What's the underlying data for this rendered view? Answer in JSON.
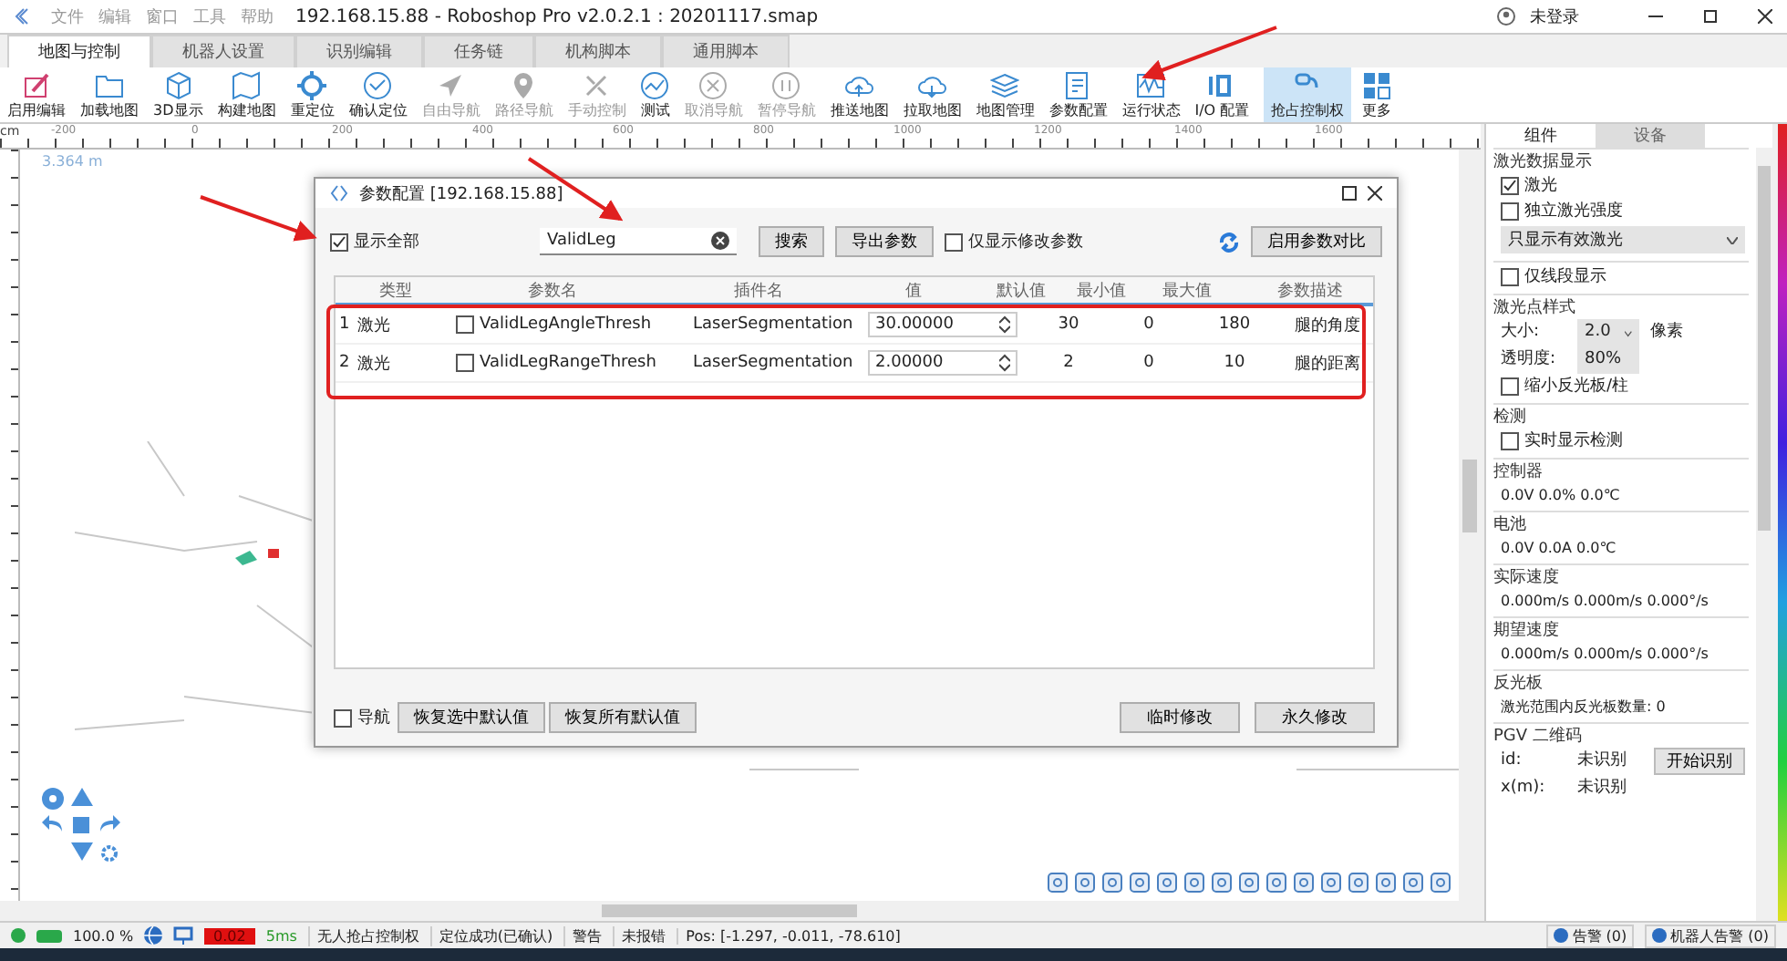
{
  "window": {
    "title": "192.168.15.88 - Roboshop Pro v2.0.2.1 : 20201117.smap",
    "menu": [
      "文件",
      "编辑",
      "窗口",
      "工具",
      "帮助"
    ],
    "user": "未登录"
  },
  "ribbon_tabs": [
    {
      "label": "地图与控制",
      "selected": true
    },
    {
      "label": "机器人设置",
      "selected": false
    },
    {
      "label": "识别编辑",
      "selected": false
    },
    {
      "label": "任务链",
      "selected": false
    },
    {
      "label": "机构脚本",
      "selected": false
    },
    {
      "label": "通用脚本",
      "selected": false
    }
  ],
  "toolbar": [
    {
      "label": "启用编辑",
      "disabled": false,
      "selected": false
    },
    {
      "label": "加载地图",
      "disabled": false,
      "selected": false
    },
    {
      "label": "3D显示",
      "disabled": false,
      "selected": false
    },
    {
      "label": "构建地图",
      "disabled": false,
      "selected": false
    },
    {
      "label": "重定位",
      "disabled": false,
      "selected": false
    },
    {
      "label": "确认定位",
      "disabled": false,
      "selected": false
    },
    {
      "label": "自由导航",
      "disabled": true,
      "selected": false
    },
    {
      "label": "路径导航",
      "disabled": true,
      "selected": false
    },
    {
      "label": "手动控制",
      "disabled": true,
      "selected": false
    },
    {
      "label": "测试",
      "disabled": false,
      "selected": false
    },
    {
      "label": "取消导航",
      "disabled": true,
      "selected": false
    },
    {
      "label": "暂停导航",
      "disabled": true,
      "selected": false
    },
    {
      "label": "推送地图",
      "disabled": false,
      "selected": false
    },
    {
      "label": "拉取地图",
      "disabled": false,
      "selected": false
    },
    {
      "label": "地图管理",
      "disabled": false,
      "selected": false
    },
    {
      "label": "参数配置",
      "disabled": false,
      "selected": false
    },
    {
      "label": "运行状态",
      "disabled": false,
      "selected": false
    },
    {
      "label": "I/O 配置",
      "disabled": false,
      "selected": false
    },
    {
      "label": "抢占控制权",
      "disabled": false,
      "selected": true
    },
    {
      "label": "更多",
      "disabled": false,
      "selected": false
    }
  ],
  "ruler": {
    "unit": "cm",
    "labels": [
      "-200",
      "0",
      "200",
      "400",
      "600",
      "800",
      "1000",
      "1200",
      "1400",
      "1600"
    ]
  },
  "scale_label": "3.364 m",
  "dialog": {
    "title": "参数配置 [192.168.15.88]",
    "show_all": {
      "label": "显示全部",
      "checked": true
    },
    "search": {
      "value": "ValidLeg"
    },
    "search_button": "搜索",
    "export_button": "导出参数",
    "modified_only": {
      "label": "仅显示修改参数",
      "checked": false
    },
    "compare_button": "启用参数对比",
    "columns": [
      "类型",
      "参数名",
      "插件名",
      "值",
      "默认值",
      "最小值",
      "最大值",
      "参数描述"
    ],
    "rows": [
      {
        "index": "1",
        "type": "激光",
        "name": "ValidLegAngleThresh",
        "checked": false,
        "plugin": "LaserSegmentation",
        "value": "30.00000",
        "default": "30",
        "min": "0",
        "max": "180",
        "description": "腿的角度"
      },
      {
        "index": "2",
        "type": "激光",
        "name": "ValidLegRangeThresh",
        "checked": false,
        "plugin": "LaserSegmentation",
        "value": "2.00000",
        "default": "2",
        "min": "0",
        "max": "10",
        "description": "腿的距离"
      }
    ],
    "nav_check": {
      "label": "导航",
      "checked": false
    },
    "footer_left": [
      "恢复选中默认值",
      "恢复所有默认值"
    ],
    "footer_right": [
      "临时修改",
      "永久修改"
    ]
  },
  "side_panel": {
    "tabs": [
      {
        "label": "组件",
        "selected": true
      },
      {
        "label": "设备",
        "selected": false
      }
    ],
    "sections": [
      {
        "title": "激光数据显示",
        "items": [
          {
            "kind": "checkbox",
            "label": "激光",
            "checked": true
          },
          {
            "kind": "checkbox",
            "label": "独立激光强度",
            "checked": false
          },
          {
            "kind": "select",
            "value": "只显示有效激光"
          }
        ]
      },
      {
        "items": [
          {
            "kind": "checkbox",
            "label": "仅线段显示",
            "checked": false
          }
        ]
      },
      {
        "title": "激光点样式",
        "items": [
          {
            "kind": "select-row",
            "label": "大小:",
            "value": "2.0",
            "unit": "像素"
          },
          {
            "kind": "select-row",
            "label": "透明度:",
            "value": "80%"
          },
          {
            "kind": "checkbox",
            "label": "缩小反光板/柱",
            "checked": false
          }
        ]
      },
      {
        "title": "检测",
        "items": [
          {
            "kind": "checkbox",
            "label": "实时显示检测",
            "checked": false
          }
        ]
      },
      {
        "title": "控制器",
        "items": [
          {
            "kind": "text",
            "text": "0.0V   0.0%   0.0℃"
          }
        ]
      },
      {
        "title": "电池",
        "items": [
          {
            "kind": "text",
            "text": "0.0V   0.0A   0.0℃"
          }
        ]
      },
      {
        "title": "实际速度",
        "items": [
          {
            "kind": "text",
            "text": "0.000m/s  0.000m/s  0.000°/s"
          }
        ]
      },
      {
        "title": "期望速度",
        "items": [
          {
            "kind": "text",
            "text": "0.000m/s  0.000m/s  0.000°/s"
          }
        ]
      },
      {
        "title": "反光板",
        "items": [
          {
            "kind": "text",
            "text": "激光范围内反光板数量: 0"
          }
        ]
      },
      {
        "title": "PGV 二维码",
        "items": [
          {
            "kind": "value-row",
            "label": "id:",
            "value": "未识别",
            "button": "开始识别"
          },
          {
            "kind": "value-row",
            "label": "x(m):",
            "value": "未识别"
          }
        ]
      }
    ]
  },
  "status_bar": {
    "battery": "100.0 %",
    "badge": "0.02",
    "latency": "5ms",
    "items": [
      "无人抢占控制权",
      "定位成功(已确认)",
      "警告",
      "未报错"
    ],
    "pos": "Pos: [-1.297, -0.011, -78.610]",
    "alerts": [
      "告警 (0)",
      "机器人告警 (0)"
    ]
  }
}
